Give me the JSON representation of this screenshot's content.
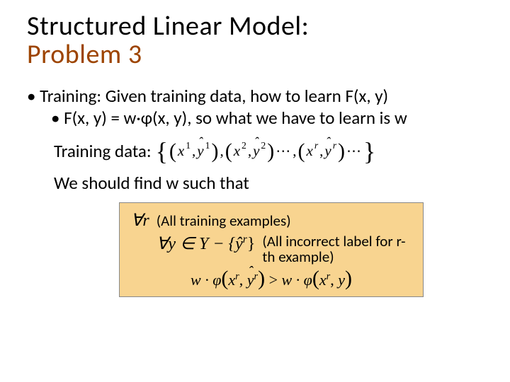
{
  "title": {
    "line1": "Structured Linear Model:",
    "line2": "Problem 3"
  },
  "bullet1": "Training: Given training data, how to learn F(x, y)",
  "bullet2": "F(x, y) = w·φ(x, y), so what we have to learn is w",
  "training_label": "Training data:",
  "math": {
    "brace_l": "{",
    "brace_r": "}",
    "paren_l": "(",
    "paren_r": ")",
    "comma": ",",
    "ellipsis": "⋯",
    "x": "x",
    "yhat": "ŷ",
    "sup1": "1",
    "sup2": "2",
    "supr": "r"
  },
  "findw": "We should find w such that",
  "box": {
    "forall_r": "∀r",
    "note1": "(All training examples)",
    "forall_y": "∀y ∈ Y − {ŷ",
    "forall_y_sup": "r",
    "forall_y_end": "}",
    "note2": "(All incorrect label for r-th example)",
    "ineq_lhs_w": "w · φ",
    "ineq_lhs_args_open": "(",
    "ineq_lhs_x": "x",
    "ineq_lhs_y": "ŷ",
    "ineq_lhs_args_close": ")",
    "gt": ">",
    "ineq_rhs_w": "w · φ",
    "ineq_rhs_args_open": "(",
    "ineq_rhs_x": "x",
    "ineq_rhs_y": "y",
    "ineq_rhs_args_close": ")",
    "sup_r": "r"
  }
}
